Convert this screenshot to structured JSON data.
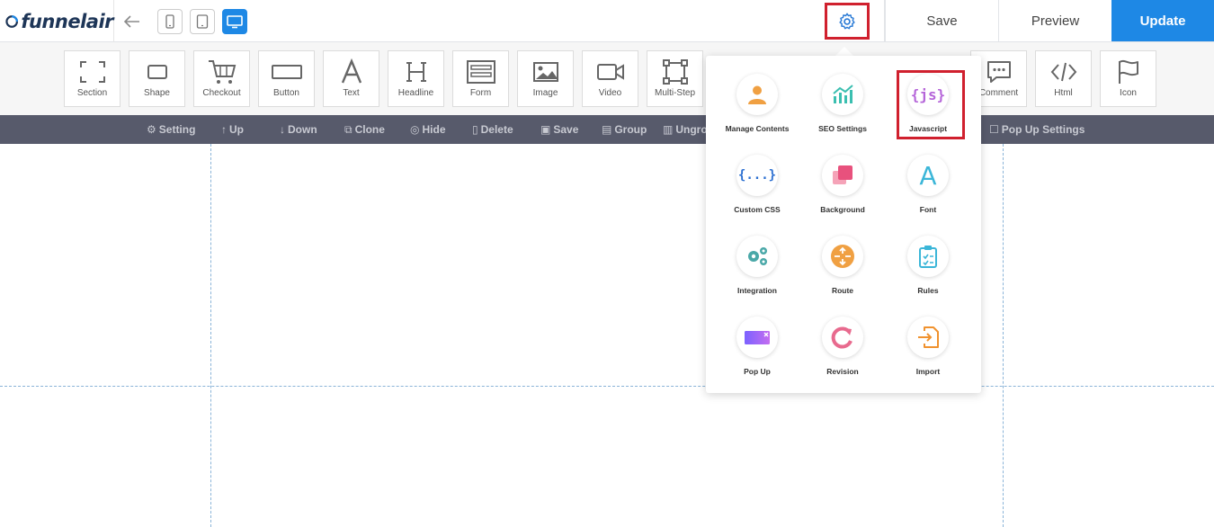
{
  "app": {
    "logo_text": "funnelair"
  },
  "header": {
    "back_icon": "arrow-left-icon",
    "devices": [
      "mobile-icon",
      "tablet-icon",
      "desktop-icon"
    ],
    "settings_icon": "gear-icon",
    "save_label": "Save",
    "preview_label": "Preview",
    "update_label": "Update"
  },
  "elements_toolbar": {
    "items": [
      {
        "label": "Section",
        "icon": "section-frame-icon"
      },
      {
        "label": "Shape",
        "icon": "shape-icon"
      },
      {
        "label": "Checkout",
        "icon": "cart-icon"
      },
      {
        "label": "Button",
        "icon": "button-icon"
      },
      {
        "label": "Text",
        "icon": "text-icon"
      },
      {
        "label": "Headline",
        "icon": "headline-icon"
      },
      {
        "label": "Form",
        "icon": "form-icon"
      },
      {
        "label": "Image",
        "icon": "image-icon"
      },
      {
        "label": "Video",
        "icon": "video-icon"
      },
      {
        "label": "Multi-Step",
        "icon": "multi-step-icon"
      },
      {
        "label": "Comment",
        "icon": "comment-icon"
      },
      {
        "label": "Html",
        "icon": "code-icon"
      },
      {
        "label": "Icon",
        "icon": "flag-icon"
      }
    ]
  },
  "action_bar": {
    "items": [
      {
        "label": "Setting",
        "icon": "gear-icon"
      },
      {
        "label": "Up",
        "icon": "arrow-up-icon"
      },
      {
        "label": "Down",
        "icon": "arrow-down-icon"
      },
      {
        "label": "Clone",
        "icon": "clone-icon"
      },
      {
        "label": "Hide",
        "icon": "eye-slash-icon"
      },
      {
        "label": "Delete",
        "icon": "trash-icon"
      },
      {
        "label": "Save",
        "icon": "save-icon"
      },
      {
        "label": "Group",
        "icon": "group-icon"
      },
      {
        "label": "Ungro",
        "icon": "ungroup-icon"
      },
      {
        "label": "Pop Up Settings",
        "icon": "checkbox-icon"
      }
    ]
  },
  "settings_menu": {
    "items": [
      {
        "label": "Manage Contents",
        "icon": "user-icon"
      },
      {
        "label": "SEO Settings",
        "icon": "chart-icon"
      },
      {
        "label": "Javascript",
        "icon": "js-icon",
        "icon_text": "{js}"
      },
      {
        "label": "Custom CSS",
        "icon": "css-braces-icon",
        "icon_text": "{...}"
      },
      {
        "label": "Background",
        "icon": "background-layers-icon"
      },
      {
        "label": "Font",
        "icon": "font-icon",
        "icon_text": "A"
      },
      {
        "label": "Integration",
        "icon": "integration-gears-icon"
      },
      {
        "label": "Route",
        "icon": "route-icon"
      },
      {
        "label": "Rules",
        "icon": "rules-clipboard-icon"
      },
      {
        "label": "Pop Up",
        "icon": "popup-icon"
      },
      {
        "label": "Revision",
        "icon": "revision-icon"
      },
      {
        "label": "Import",
        "icon": "import-icon"
      }
    ]
  },
  "colors": {
    "accent": "#1e88e5",
    "highlight": "#d0202e",
    "action_bar_bg": "#575a6b",
    "logo_navy": "#1d3557"
  }
}
